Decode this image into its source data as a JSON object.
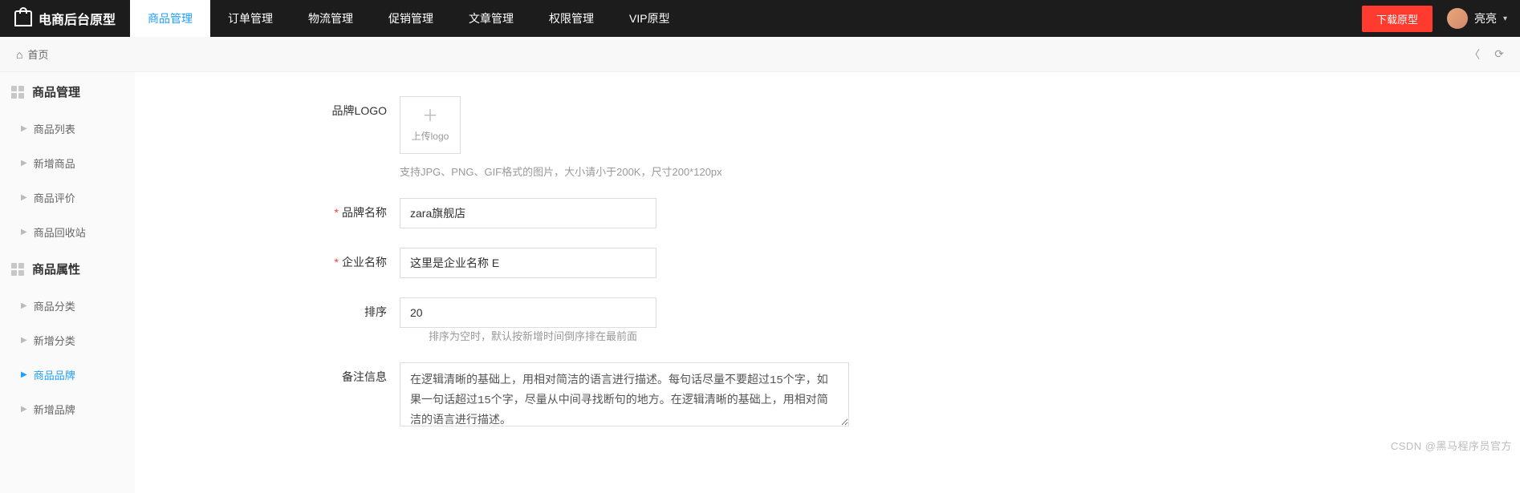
{
  "header": {
    "logo_text": "电商后台原型",
    "nav": [
      "商品管理",
      "订单管理",
      "物流管理",
      "促销管理",
      "文章管理",
      "权限管理",
      "VIP原型"
    ],
    "active_nav_index": 0,
    "download_label": "下载原型",
    "user_name": "亮亮"
  },
  "subheader": {
    "breadcrumb": "首页"
  },
  "sidebar": {
    "groups": [
      {
        "title": "商品管理",
        "items": [
          "商品列表",
          "新增商品",
          "商品评价",
          "商品回收站"
        ]
      },
      {
        "title": "商品属性",
        "items": [
          "商品分类",
          "新增分类",
          "商品品牌",
          "新增品牌"
        ]
      }
    ],
    "active_item": "商品品牌"
  },
  "form": {
    "logo": {
      "label": "品牌LOGO",
      "upload_text": "上传logo",
      "hint": "支持JPG、PNG、GIF格式的图片，大小请小于200K，尺寸200*120px"
    },
    "brand_name": {
      "label": "品牌名称",
      "value": "zara旗舰店",
      "required": true
    },
    "company_name": {
      "label": "企业名称",
      "value": "这里是企业名称 E",
      "required": true
    },
    "sort": {
      "label": "排序",
      "value": "20",
      "hint": "排序为空时，默认按新增时间倒序排在最前面"
    },
    "remark": {
      "label": "备注信息",
      "value": "在逻辑清晰的基础上，用相对简洁的语言进行描述。每句话尽量不要超过15个字，如果一句话超过15个字，尽量从中间寻找断句的地方。在逻辑清晰的基础上，用相对简洁的语言进行描述。"
    }
  },
  "watermark": "CSDN @黑马程序员官方"
}
